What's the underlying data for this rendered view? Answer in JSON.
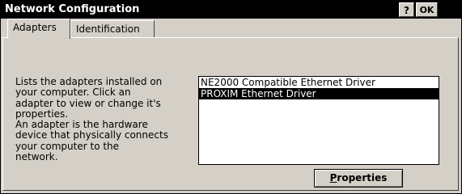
{
  "window": {
    "title": "Network Configuration",
    "help_label": "?",
    "ok_label": "OK",
    "close_label": "×"
  },
  "tabs": [
    {
      "label": "Adapters",
      "active": true
    },
    {
      "label": "Identification",
      "active": false
    }
  ],
  "description": "Lists the adapters installed on\nyour computer.  Click an\nadapter to view or change it's\nproperties.\nAn adapter is the hardware\ndevice that physically connects\nyour computer to the\nnetwork.",
  "adapters": [
    {
      "label": "NE2000 Compatible Ethernet Driver",
      "selected": false
    },
    {
      "label": "PROXIM Ethernet Driver",
      "selected": true
    }
  ],
  "properties_button": {
    "label_first": "P",
    "label_rest": "roperties"
  },
  "colors": {
    "titlebar": "#000000",
    "face": "#d4d0c8",
    "selection": "#000000"
  }
}
